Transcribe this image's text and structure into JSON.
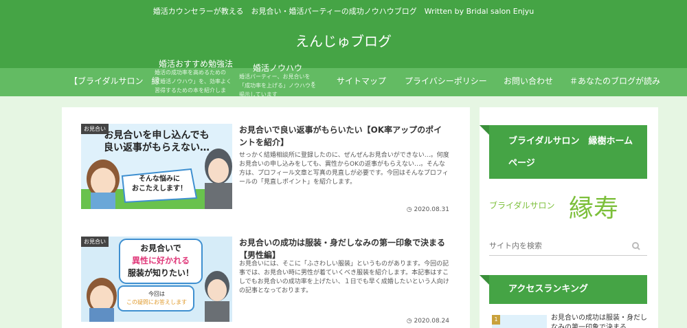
{
  "header": {
    "tagline": "婚活カウンセラーが教える　お見合い・婚活パーティーの成功ノウハウブログ　Written by Bridal salon Enjyu",
    "site_title": "えんじゅブログ"
  },
  "nav": {
    "items": [
      {
        "label": "【ブライダルサロン　縁"
      },
      {
        "label": "サイトマップ"
      },
      {
        "label": "プライバシーポリシー"
      },
      {
        "label": "お問い合わせ"
      },
      {
        "label": "＃あなたのブログが読み"
      }
    ],
    "drop1": {
      "title": "婚活おすすめ勉強法",
      "desc": "婚活の成功率を高めるための「婚活ノウハウ」を、効率よく習得するための本を紹介しま"
    },
    "drop2": {
      "title": "婚活ノウハウ",
      "desc": "婚活パーティー、お見合いを「成功率を上げる」ノウハウを掲示しています"
    }
  },
  "posts": [
    {
      "category": "お見合い",
      "thumb_text1": "お見合いを申し込んでも",
      "thumb_text2": "良い返事がもらえない…",
      "thumb_bubble1": "そんな悩みに",
      "thumb_bubble2": "おこたえします！",
      "title": "お見合いで良い返事がもらいたい【OK率アップのポイントを紹介】",
      "excerpt": "せっかく結婚相談所に登録したのに、ぜんぜんお見合いができない…。何度お見合いの申し込みをしても、異性からOKの返事がもらえない…。そんな方は、プロフィール文章と写真の見直しが必要です。今回はそんなプロフィールの「見直しポイント」を紹介します。",
      "date": "2020.08.31"
    },
    {
      "category": "お見合い",
      "thumb_text1": "お見合いで",
      "thumb_text2": "異性に好かれる",
      "thumb_text3": "服装が知りたい！",
      "thumb_bubble1": "今回は",
      "thumb_bubble2": "この疑問にお答えします",
      "title": "お見合いの成功は服装・身だしなみの第一印象で決まる【男性編】",
      "excerpt": "お見合いには、そこに「ふさわしい服装」というものがあります。今回の記事では、お見合い時に男性が着ていくべき服装を紹介します。本記事はすこしでもお見合いの成功率を上げたい、１日でも早く成婚したいという人向けの記事となっております。",
      "date": "2020.08.24"
    }
  ],
  "sidebar": {
    "banner1": "ブライダルサロン　縁樹ホームページ",
    "logo_small": "ブライダルサロン",
    "logo_large": "縁寿",
    "search_placeholder": "サイト内を検索",
    "banner2": "アクセスランキング",
    "rank": [
      {
        "num": "1",
        "title": "お見合いの成功は服装・身だしなみの第一印象で決まる"
      }
    ]
  },
  "colors": {
    "header": "#45a445",
    "nav": "#63bb63",
    "background": "#e6f6e3"
  }
}
